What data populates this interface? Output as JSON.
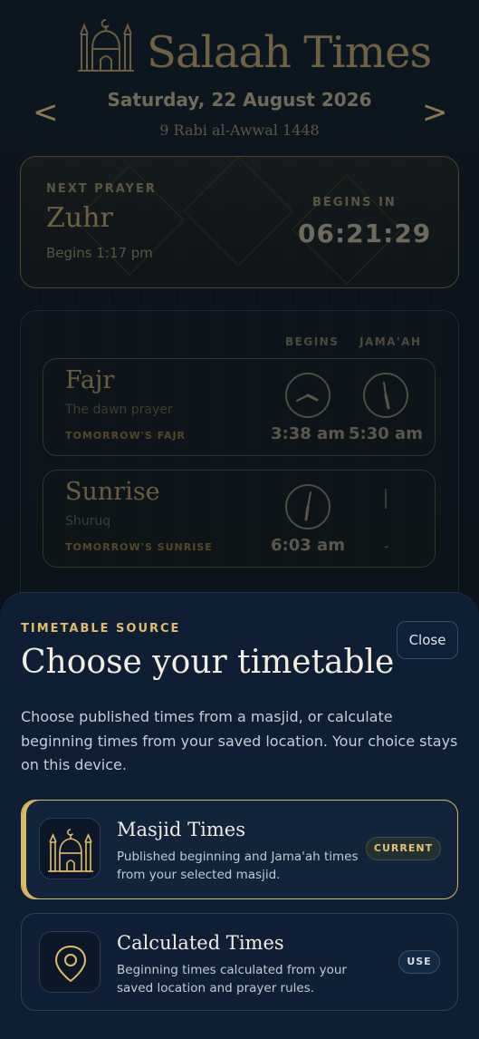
{
  "app": {
    "title": "Salaah Times",
    "logo_icon": "mosque-icon"
  },
  "date_nav": {
    "prev_label": "<",
    "next_label": ">",
    "gregorian": "Saturday, 22 August 2026",
    "hijri": "9 Rabi al-Awwal 1448"
  },
  "next_prayer": {
    "label": "NEXT PRAYER",
    "name": "Zuhr",
    "begins_text": "Begins 1:17 pm",
    "begins_in_label": "BEGINS IN",
    "countdown": "06:21:29"
  },
  "prayer_table": {
    "col_begins": "BEGINS",
    "col_jamaah": "JAMA'AH",
    "rows": [
      {
        "name": "Fajr",
        "subtitle": "The dawn prayer",
        "note": "TOMORROW'S FAJR",
        "begins": "3:38 am",
        "jamaah": "5:30 am"
      },
      {
        "name": "Sunrise",
        "subtitle": "Shuruq",
        "note": "TOMORROW'S SUNRISE",
        "begins": "6:03 am",
        "jamaah": "-"
      }
    ]
  },
  "sheet": {
    "eyebrow": "TIMETABLE SOURCE",
    "title": "Choose your timetable",
    "close_label": "Close",
    "description": "Choose published times from a masjid, or calculate beginning times from your saved location. Your choice stays on this device.",
    "options": [
      {
        "title": "Masjid Times",
        "description": "Published beginning and Jama'ah times from your selected masjid.",
        "badge": "CURRENT",
        "icon": "mosque-icon",
        "selected": true
      },
      {
        "title": "Calculated Times",
        "description": "Beginning times calculated from your saved location and prayer rules.",
        "badge": "USE",
        "icon": "location-pin-icon",
        "selected": false
      }
    ]
  },
  "colors": {
    "accent_gold": "#d8b865",
    "sheet_bg": "#0e1e33",
    "page_bg": "#0a1118"
  }
}
